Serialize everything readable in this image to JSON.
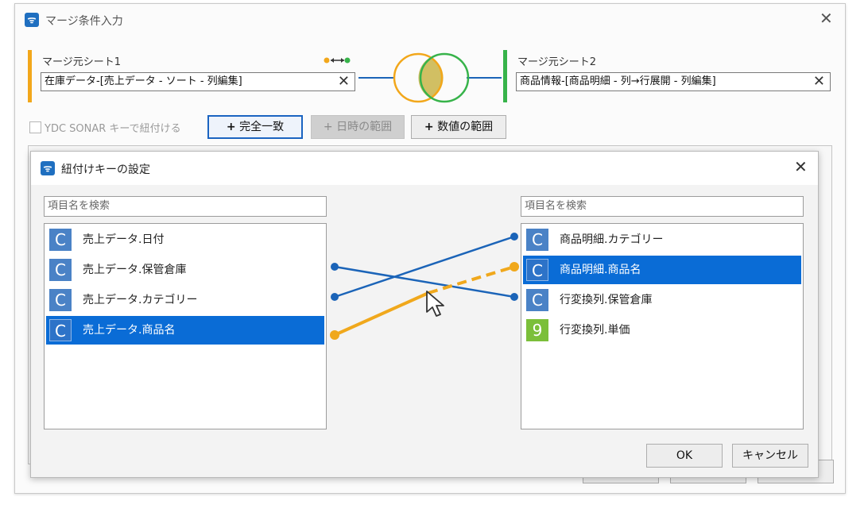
{
  "outer_dialog": {
    "title": "マージ条件入力",
    "source1": {
      "label": "マージ元シート1",
      "value": "在庫データ-[売上データ - ソート - 列編集]"
    },
    "source2": {
      "label": "マージ元シート2",
      "value": "商品情報-[商品明細 - 列→行展開 - 列編集]"
    },
    "ydc_checkbox_label": "YDC SONAR キーで紐付ける",
    "buttons": {
      "exact_match": "完全一致",
      "date_range": "日時の範囲",
      "numeric_range": "数値の範囲"
    }
  },
  "inner_dialog": {
    "title": "紐付けキーの設定",
    "left_search_placeholder": "項目名を検索",
    "right_search_placeholder": "項目名を検索",
    "left_items": [
      {
        "badge": "C",
        "label": "売上データ.日付",
        "selected": false
      },
      {
        "badge": "C",
        "label": "売上データ.保管倉庫",
        "selected": false
      },
      {
        "badge": "C",
        "label": "売上データ.カテゴリー",
        "selected": false
      },
      {
        "badge": "C",
        "label": "売上データ.商品名",
        "selected": true
      }
    ],
    "right_items": [
      {
        "badge": "C",
        "label": "商品明細.カテゴリー",
        "selected": false
      },
      {
        "badge": "C",
        "label": "商品明細.商品名",
        "selected": true
      },
      {
        "badge": "C",
        "label": "行変換列.保管倉庫",
        "selected": false
      },
      {
        "badge": "9",
        "label": "行変換列.単価",
        "selected": false
      }
    ],
    "ok_label": "OK",
    "cancel_label": "キャンセル"
  },
  "colors": {
    "accent_blue": "#0a6cd6",
    "link_blue": "#1b64b8",
    "link_orange": "#f0a81c",
    "sheet1_orange": "#f2a71b",
    "sheet2_green": "#37b34a"
  },
  "icons": [
    "app-icon",
    "close-icon",
    "plus-icon",
    "venn-icon",
    "mouse-cursor-icon"
  ]
}
